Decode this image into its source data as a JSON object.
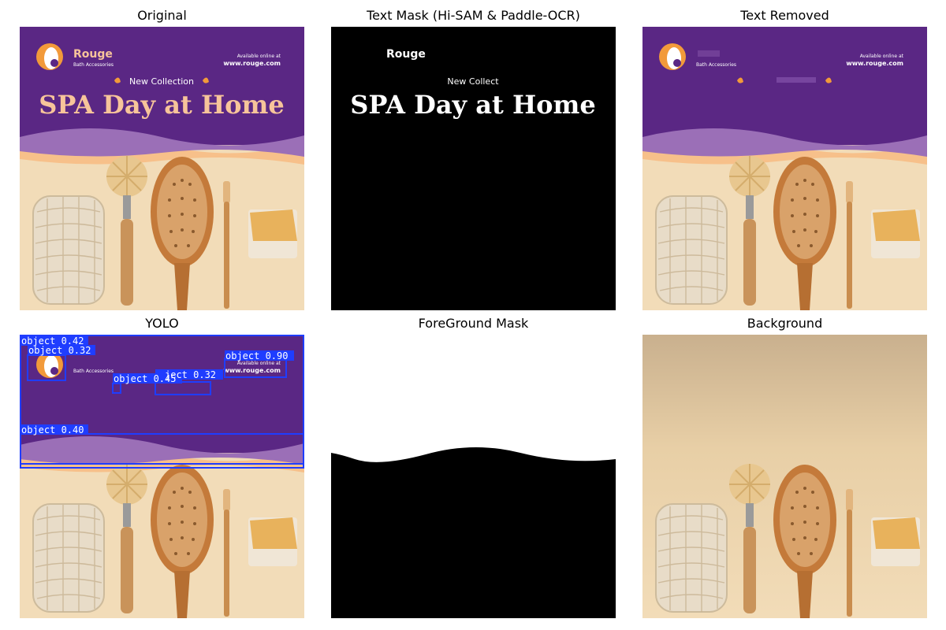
{
  "figure": {
    "panels": [
      {
        "id": "original",
        "title": "Original"
      },
      {
        "id": "text_mask",
        "title": "Text Mask (Hi-SAM & Paddle-OCR)"
      },
      {
        "id": "text_removed",
        "title": "Text Removed"
      },
      {
        "id": "yolo",
        "title": "YOLO"
      },
      {
        "id": "foreground_mask",
        "title": "ForeGround Mask"
      },
      {
        "id": "background",
        "title": "Background"
      }
    ]
  },
  "poster": {
    "brand": "Rouge",
    "brand_sub": "Bath Accessories",
    "available": "Available online at",
    "url": "www.rouge.com",
    "collection": "New Collection",
    "headline": "SPA Day at Home",
    "colors": {
      "purple": "#5a2784",
      "lavender": "#9b6fb7",
      "cream": "#f2dcb8",
      "peach": "#f7c08a",
      "headline": "#f7c49a",
      "orange": "#f29a3a"
    }
  },
  "mask": {
    "brand": "Rouge",
    "collection": "New Collect",
    "headline": "SPA Day at Home"
  },
  "yolo": {
    "box_color": "#1f3dff",
    "detections": [
      {
        "label": "object 0.42"
      },
      {
        "label": "object 0.32"
      },
      {
        "label": "object 0.90"
      },
      {
        "label": "object 0.45"
      },
      {
        "label": "ject 0.32"
      },
      {
        "label": "object 0.40"
      }
    ]
  }
}
